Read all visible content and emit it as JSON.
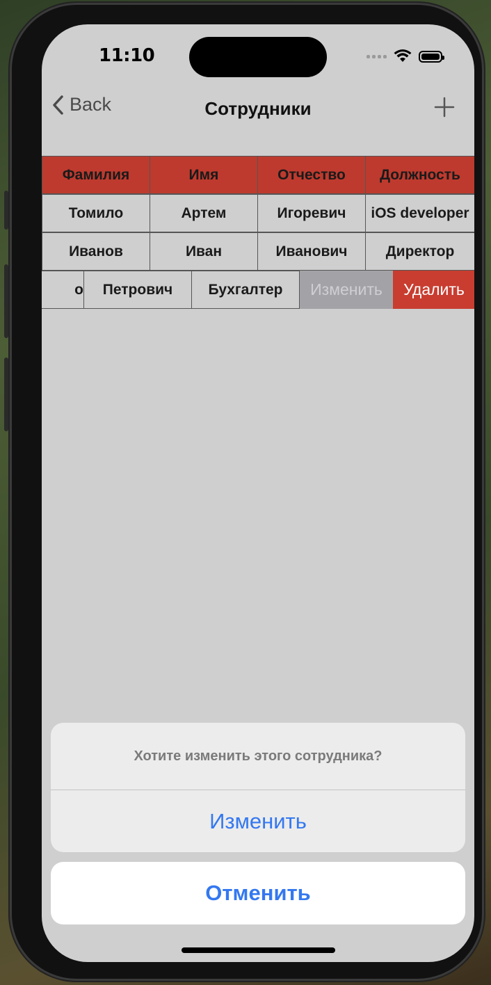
{
  "status": {
    "time": "11:10"
  },
  "nav": {
    "back_label": "Back",
    "title": "Сотрудники"
  },
  "table": {
    "headers": [
      "Фамилия",
      "Имя",
      "Отчество",
      "Должность"
    ],
    "rows": [
      [
        "Томило",
        "Артем",
        "Игоревич",
        "iOS developer"
      ],
      [
        "Иванов",
        "Иван",
        "Иванович",
        "Директор"
      ]
    ],
    "swiped_row": {
      "cells": [
        "о",
        "Петрович",
        "Бухгалтер"
      ],
      "edit_label": "Изменить",
      "delete_label": "Удалить"
    }
  },
  "action_sheet": {
    "message": "Хотите изменить этого сотрудника?",
    "confirm_label": "Изменить",
    "cancel_label": "Отменить"
  },
  "colors": {
    "header_red": "#be3a2e",
    "delete_red": "#c83d30",
    "edit_gray": "#a3a3a7",
    "ios_blue": "#3478f0"
  },
  "icons": [
    "chevron-left-icon",
    "plus-icon",
    "wifi-icon",
    "battery-icon",
    "signal-icon"
  ]
}
